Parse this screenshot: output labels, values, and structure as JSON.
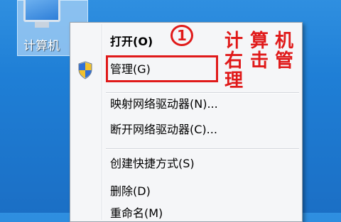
{
  "desktop": {
    "icon_label": "计算机"
  },
  "menu": {
    "items": [
      {
        "label": "打开(O)"
      },
      {
        "label": "管理(G)"
      },
      {
        "label": "映射网络驱动器(N)..."
      },
      {
        "label": "断开网络驱动器(C)..."
      },
      {
        "label": "创建快捷方式(S)"
      },
      {
        "label": "删除(D)"
      },
      {
        "label": "重命名(M)"
      }
    ]
  },
  "annotation": {
    "step_number": "1",
    "col1": "计右理",
    "col2": "算击",
    "col3": "机管",
    "accent_color": "#e01a1a"
  }
}
